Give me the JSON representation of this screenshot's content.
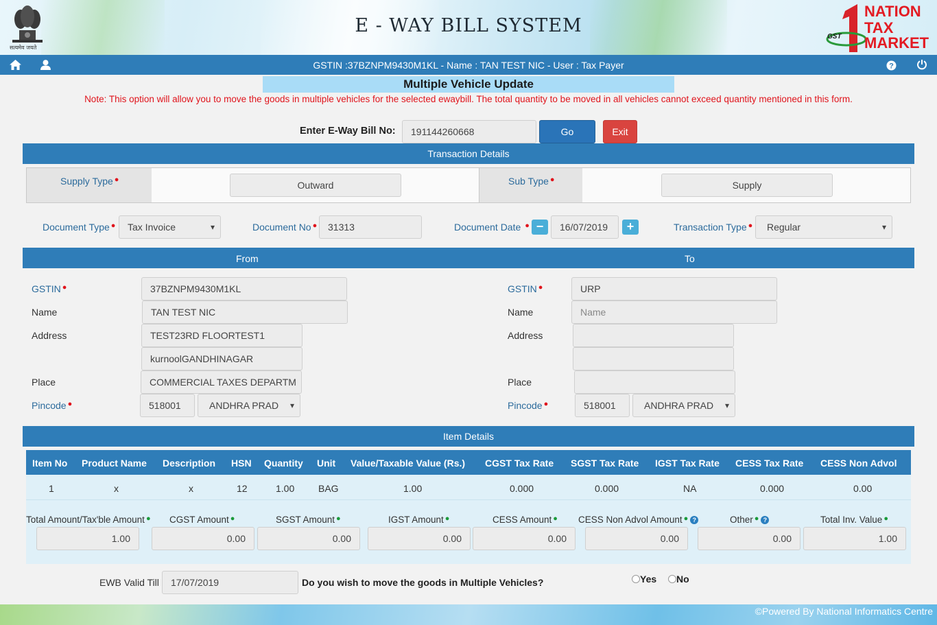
{
  "header": {
    "title": "E - WAY BILL SYSTEM",
    "emblem_text": "सत्यमेव जयते",
    "brand_lines": [
      "NATION",
      "TAX",
      "MARKET"
    ],
    "brand_badge": "GST"
  },
  "topbar": {
    "info": "GSTIN :37BZNPM9430M1KL - Name : TAN TEST NIC - User : Tax Payer"
  },
  "page": {
    "title": "Multiple Vehicle Update",
    "note": "Note: This option will allow you to move the goods in multiple vehicles for the selected ewaybill. The total quantity to be moved in all vehicles cannot exceed quantity mentioned in this form."
  },
  "ewb": {
    "label": "Enter E-Way Bill No:",
    "value": "191144260668",
    "go_label": "Go",
    "exit_label": "Exit"
  },
  "transaction": {
    "heading": "Transaction Details",
    "supply_type_label": "Supply Type",
    "supply_type_value": "Outward",
    "sub_type_label": "Sub Type",
    "sub_type_value": "Supply",
    "document_type_label": "Document Type",
    "document_type_value": "Tax Invoice",
    "document_no_label": "Document No",
    "document_no_value": "31313",
    "document_date_label": "Document Date",
    "document_date_value": "16/07/2019",
    "minus": "−",
    "plus": "+",
    "transaction_type_label": "Transaction Type",
    "transaction_type_value": "Regular"
  },
  "from": {
    "heading": "From",
    "gstin_label": "GSTIN",
    "gstin_value": "37BZNPM9430M1KL",
    "name_label": "Name",
    "name_value": "TAN TEST NIC",
    "address_label": "Address",
    "address1": "TEST23RD FLOORTEST1",
    "address2": "kurnoolGANDHINAGAR",
    "place_label": "Place",
    "place_value": "COMMERCIAL TAXES DEPARTM",
    "pincode_label": "Pincode",
    "pincode_value": "518001",
    "state_value": "ANDHRA PRAD"
  },
  "to": {
    "heading": "To",
    "gstin_label": "GSTIN",
    "gstin_value": "URP",
    "name_label": "Name",
    "name_placeholder": "Name",
    "address_label": "Address",
    "address1": "",
    "address2": "",
    "place_label": "Place",
    "place_value": "",
    "pincode_label": "Pincode",
    "pincode_value": "518001",
    "state_value": "ANDHRA PRAD"
  },
  "items": {
    "heading": "Item Details",
    "columns": [
      "Item No",
      "Product Name",
      "Description",
      "HSN",
      "Quantity",
      "Unit",
      "Value/Taxable Value (Rs.)",
      "CGST Tax Rate",
      "SGST Tax Rate",
      "IGST Tax Rate",
      "CESS Tax Rate",
      "CESS Non Advol"
    ],
    "rows": [
      [
        "1",
        "x",
        "x",
        "12",
        "1.00",
        "BAG",
        "1.00",
        "0.000",
        "0.000",
        "NA",
        "0.000",
        "0.00"
      ]
    ]
  },
  "totals": {
    "labels": [
      "Total Amount/Tax'ble Amount",
      "CGST Amount",
      "SGST Amount",
      "IGST Amount",
      "CESS Amount",
      "CESS Non Advol Amount",
      "Other",
      "Total Inv. Value"
    ],
    "values": [
      "1.00",
      "0.00",
      "0.00",
      "0.00",
      "0.00",
      "0.00",
      "0.00",
      "1.00"
    ]
  },
  "bottom": {
    "valid_till_label": "EWB Valid Till",
    "valid_till_value": "17/07/2019",
    "question": "Do you wish to move the goods in Multiple Vehicles?",
    "yes_label": "Yes",
    "no_label": "No"
  },
  "footer": {
    "text": "Powered By National Informatics Centre",
    "copyright_symbol": "©"
  },
  "colors": {
    "primary_bar": "#2f7db8",
    "title_band": "#a9dcf7",
    "note_red": "#e0141c",
    "go_blue": "#2a74b8",
    "exit_red": "#d9443f"
  }
}
